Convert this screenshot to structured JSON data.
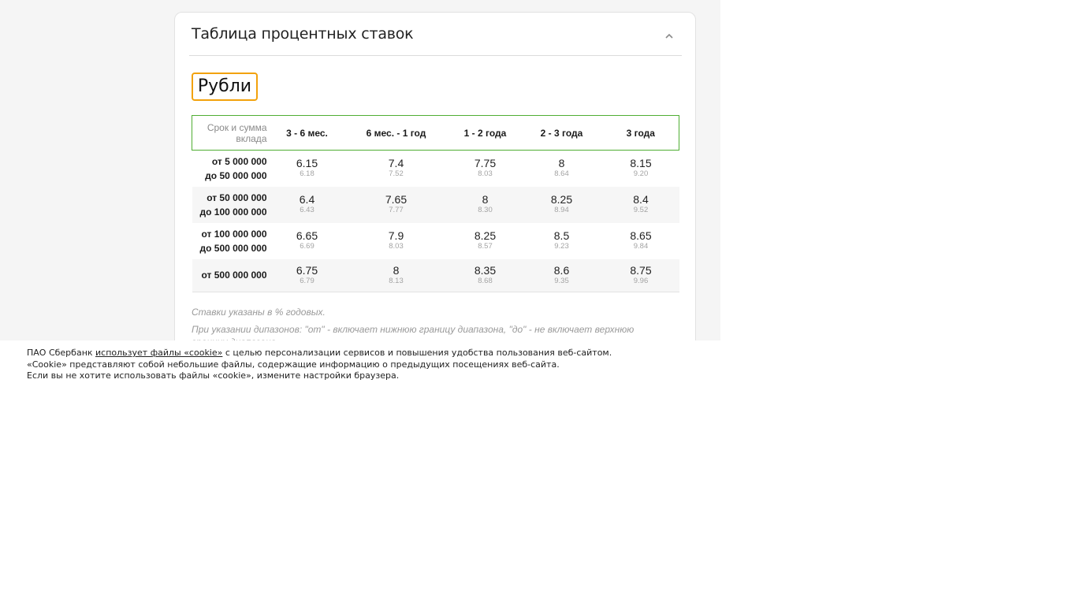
{
  "card": {
    "title": "Таблица процентных ставок",
    "collapse_icon": "chevron-up-icon"
  },
  "currency_tab": {
    "label": "Рубли",
    "accent_color": "#f2a20c"
  },
  "table": {
    "header_first_line1": "Срок и сумма",
    "header_first_line2": "вклада",
    "columns": [
      "3 - 6 мес.",
      "6 мес. - 1 год",
      "1 - 2 года",
      "2 - 3 года",
      "3 года"
    ],
    "border_color": "#4fae33",
    "rows": [
      {
        "from": "от 5 000 000",
        "to": "до 50 000 000",
        "rates": [
          {
            "rate": "6.15",
            "effective": "6.18"
          },
          {
            "rate": "7.4",
            "effective": "7.52"
          },
          {
            "rate": "7.75",
            "effective": "8.03"
          },
          {
            "rate": "8",
            "effective": "8.64"
          },
          {
            "rate": "8.15",
            "effective": "9.20"
          }
        ]
      },
      {
        "from": "от 50 000 000",
        "to": "до 100 000 000",
        "rates": [
          {
            "rate": "6.4",
            "effective": "6.43"
          },
          {
            "rate": "7.65",
            "effective": "7.77"
          },
          {
            "rate": "8",
            "effective": "8.30"
          },
          {
            "rate": "8.25",
            "effective": "8.94"
          },
          {
            "rate": "8.4",
            "effective": "9.52"
          }
        ]
      },
      {
        "from": "от 100 000 000",
        "to": "до 500 000 000",
        "rates": [
          {
            "rate": "6.65",
            "effective": "6.69"
          },
          {
            "rate": "7.9",
            "effective": "8.03"
          },
          {
            "rate": "8.25",
            "effective": "8.57"
          },
          {
            "rate": "8.5",
            "effective": "9.23"
          },
          {
            "rate": "8.65",
            "effective": "9.84"
          }
        ]
      },
      {
        "from": "от 500 000 000",
        "to": "",
        "rates": [
          {
            "rate": "6.75",
            "effective": "6.79"
          },
          {
            "rate": "8",
            "effective": "8.13"
          },
          {
            "rate": "8.35",
            "effective": "8.68"
          },
          {
            "rate": "8.6",
            "effective": "9.35"
          },
          {
            "rate": "8.75",
            "effective": "9.96"
          }
        ]
      }
    ]
  },
  "notes": {
    "note1": "Ставки указаны в % годовых.",
    "note2": "При указании дипазонов: \"от\" - включает нижнюю границу диапазона, \"до\" - не включает верхнюю границу диапазона"
  },
  "cookie_banner": {
    "line1_prefix": "ПАО Сбербанк ",
    "line1_link": "использует файлы «cookie»",
    "line1_suffix": " с целью персонализации сервисов и повышения удобства пользования веб-сайтом.",
    "line2": "«Cookie» представляют собой небольшие файлы, содержащие информацию о предыдущих посещениях веб-сайта.",
    "line3": "Если вы не хотите использовать файлы «cookie», измените настройки браузера."
  }
}
